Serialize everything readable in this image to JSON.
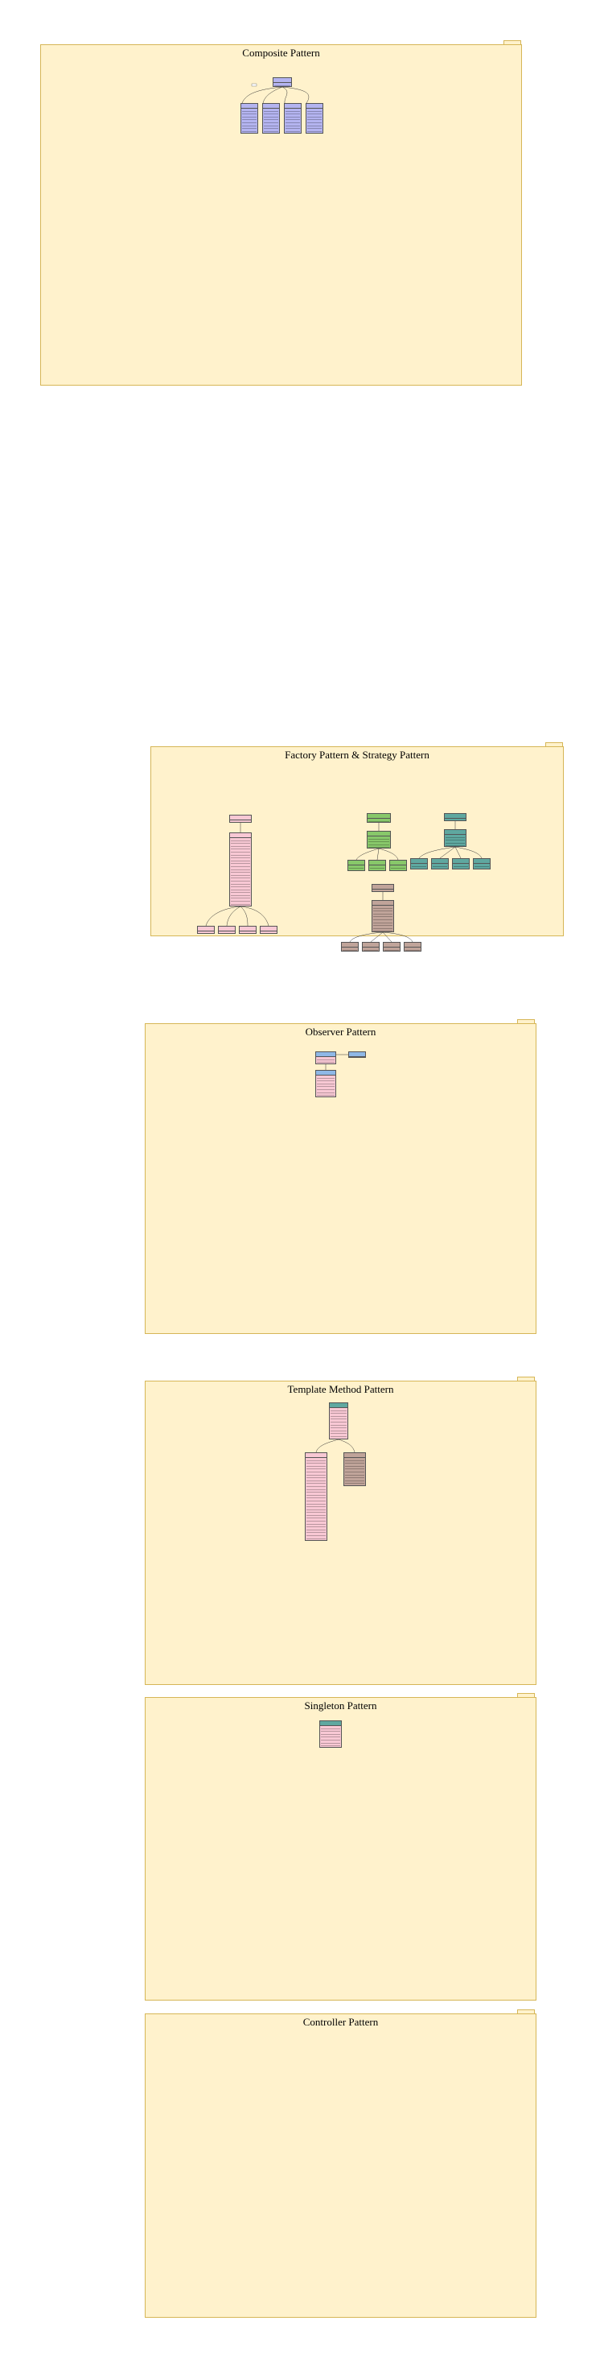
{
  "colors": {
    "package_fill": "#fff2cc",
    "package_border": "#d6b656",
    "class_blue": "#b4b4f0",
    "class_pink": "#f8c8d4",
    "class_green": "#88c86a",
    "class_teal": "#5fa8a0",
    "class_brown": "#c0a49a"
  },
  "packages": {
    "composite": {
      "title": "Composite Pattern"
    },
    "factory_strategy": {
      "title": "Factory Pattern & Strategy Pattern"
    },
    "observer": {
      "title": "Observer Pattern"
    },
    "template_method": {
      "title": "Template Method Pattern"
    },
    "singleton": {
      "title": "Singleton Pattern"
    },
    "controller": {
      "title": "Controller Pattern"
    }
  }
}
